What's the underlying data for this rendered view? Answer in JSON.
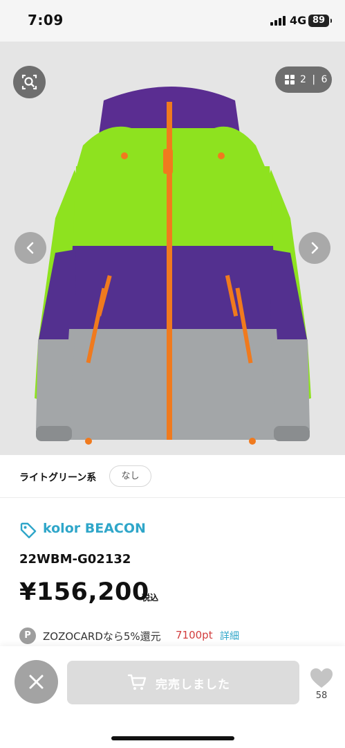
{
  "status_bar": {
    "time": "7:09",
    "network": "4G",
    "battery": "89"
  },
  "gallery": {
    "counter": "2 | 6",
    "current": 2,
    "total": 6
  },
  "variant": {
    "color_name": "ライトグリーン系",
    "size_chip": "なし"
  },
  "product": {
    "brand": "kolor BEACON",
    "code": "22WBM-G02132",
    "price": "¥156,200",
    "tax_label": "税込"
  },
  "points": {
    "badge": "P",
    "text": "ZOZOCARDなら5%還元",
    "value": "7100pt",
    "detail_link": "詳細"
  },
  "action_bar": {
    "soldout_label": "完売しました",
    "favorite_count": "58"
  },
  "icons": [
    "zoom-search-icon",
    "grid-icon",
    "chevron-left-icon",
    "chevron-right-icon",
    "tag-icon",
    "close-icon",
    "cart-icon",
    "heart-icon"
  ],
  "colors": {
    "brand_accent": "#2fa6c9",
    "points_red": "#d23c3c",
    "soldout_gray": "#dcdcdc"
  }
}
